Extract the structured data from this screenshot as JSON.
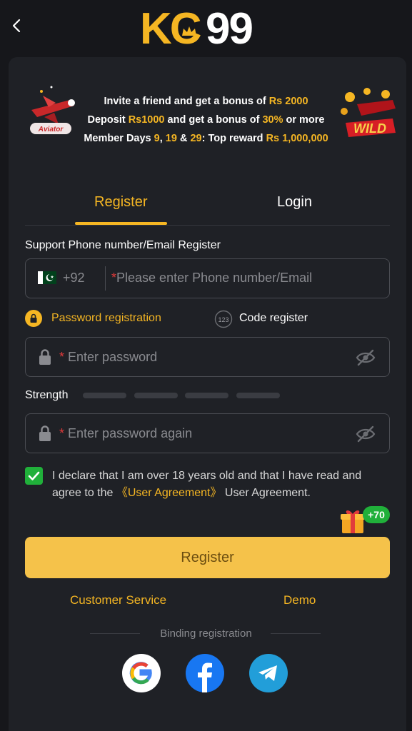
{
  "header": {
    "back_icon": "chevron-left-icon",
    "logo_kc": "KC",
    "logo_99": "99"
  },
  "promo": {
    "line1_a": "Invite a friend and get a bonus of ",
    "line1_b": "Rs 2000",
    "line2_a": "Deposit ",
    "line2_b": "Rs1000",
    "line2_c": " and get a bonus of ",
    "line2_d": "30%",
    "line2_e": " or more",
    "line3_a": "Member Days ",
    "line3_b": "9",
    "line3_c": ", ",
    "line3_d": "19",
    "line3_e": " & ",
    "line3_f": "29",
    "line3_g": ": Top reward ",
    "line3_h": "Rs 1,000,000",
    "left_badge": "Aviator",
    "right_badge": "WILD"
  },
  "tabs": {
    "register": "Register",
    "login": "Login",
    "active": "Register"
  },
  "form": {
    "support_label": "Support Phone number/Email Register",
    "country_code": "+92",
    "phone_asterisk": "*",
    "phone_placeholder": "Please enter Phone number/Email",
    "password_mode_label": "Password registration",
    "code_mode_icon_text": "123",
    "code_mode_label": "Code register",
    "password_asterisk": "*",
    "password_placeholder": "Enter password",
    "strength_label": "Strength",
    "confirm_asterisk": "*",
    "confirm_placeholder": "Enter password again",
    "declaration_a": "I declare that I am over 18 years old and that I have read and agree to the ",
    "declaration_link": "《User Agreement》",
    "declaration_b": " User Agreement.",
    "agree_checked": true,
    "bonus_badge": "+70",
    "register_button": "Register"
  },
  "footer": {
    "customer_service": "Customer Service",
    "demo": "Demo",
    "binding_label": "Binding registration",
    "social": [
      "google-icon",
      "facebook-icon",
      "telegram-icon"
    ]
  },
  "colors": {
    "accent": "#f5b623",
    "background": "#16171b",
    "card": "#1f2126",
    "success": "#20b03a",
    "facebook": "#1877f2",
    "telegram": "#229ed9"
  }
}
